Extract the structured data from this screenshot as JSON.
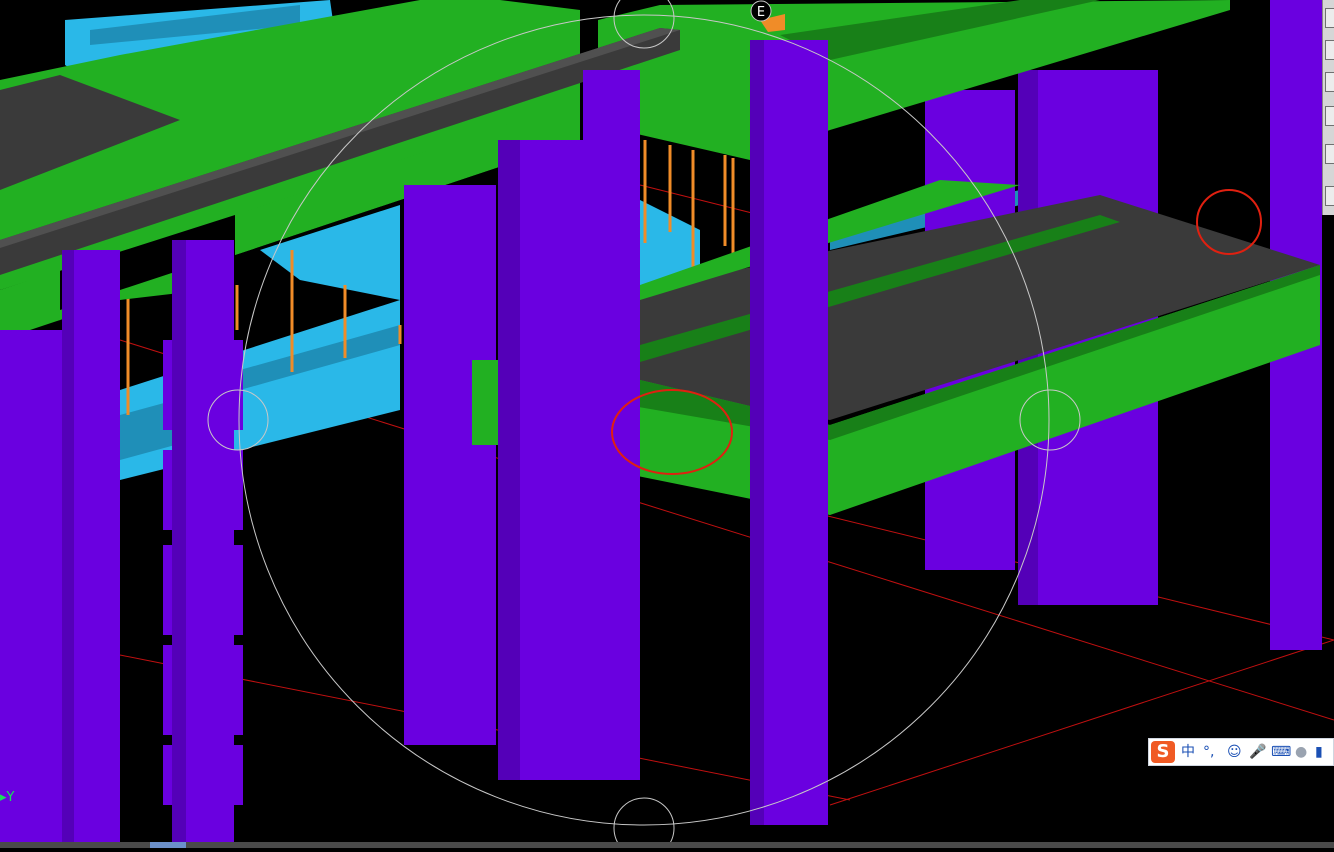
{
  "viewport": {
    "compass_label": "E",
    "axis_label": "Y",
    "colors": {
      "background": "#000000",
      "column": "#6a00e0",
      "column_dark": "#5400b8",
      "beam": "#22b022",
      "beam_dark": "#188018",
      "slab": "#3a3a3a",
      "stair": "#2ab8e8",
      "rebar": "#f08c28",
      "orbit": "#c8c8c8",
      "highlight": "#e02010"
    }
  },
  "ime_bar": {
    "logo": "S",
    "mode": "中",
    "punct": "°,",
    "icons": [
      "emoji-icon",
      "microphone-icon",
      "keyboard-icon",
      "user-icon",
      "skin-icon"
    ]
  }
}
